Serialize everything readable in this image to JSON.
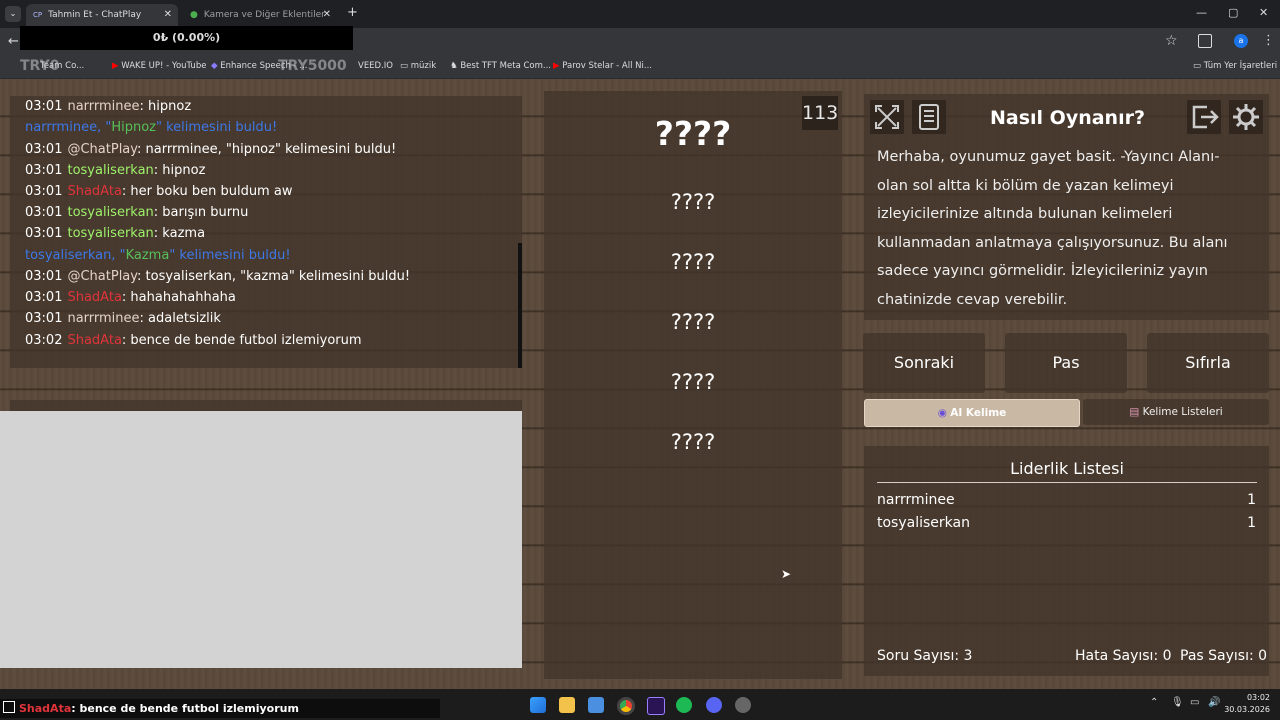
{
  "browser": {
    "tabs": [
      {
        "label": "Tahmin Et - ChatPlay",
        "favicon": "CP",
        "active": true
      },
      {
        "label": "Kamera ve Diğer Eklentiler",
        "active": false
      }
    ],
    "new_tab": "+",
    "window_controls": {
      "minimize": "—",
      "maximize": "▢",
      "close": "✕"
    }
  },
  "overlay": {
    "balance": "0₺ (0.00%)",
    "ghost_left": "TRY0",
    "ghost_right": "TRY5000"
  },
  "bookmarks": {
    "items": [
      "Team Co...",
      "WAKE UP! - YouTube",
      "Enhance Speech - ...",
      "VEED.IO",
      "müzik",
      "Best TFT Meta Com...",
      "Parov Stelar - All Ni..."
    ],
    "all_bookmarks": "Tüm Yer İşaretleri"
  },
  "chat": {
    "lines": [
      {
        "time": "03:01",
        "user": "narrrminee",
        "user_color": "gray",
        "text": ": hipnoz"
      },
      {
        "time": "",
        "user": "narrrminee,",
        "user_color": "blue",
        "text_parts": [
          " \"",
          "Hipnoz",
          "\" kelimesini buldu!"
        ],
        "system": true
      },
      {
        "time": "03:01",
        "user": "@ChatPlay",
        "user_color": "gray",
        "text": ": narrrminee, \"hipnoz\" kelimesini buldu!"
      },
      {
        "time": "03:01",
        "user": "tosyaliserkan",
        "user_color": "green",
        "text": ": hipnoz"
      },
      {
        "time": "03:01",
        "user": "ShadAta",
        "user_color": "red",
        "text": ": her boku ben buldum aw"
      },
      {
        "time": "03:01",
        "user": "tosyaliserkan",
        "user_color": "green",
        "text": ": barışın burnu"
      },
      {
        "time": "03:01",
        "user": "tosyaliserkan",
        "user_color": "green",
        "text": ": kazma"
      },
      {
        "time": "",
        "user": "tosyaliserkan,",
        "user_color": "blue",
        "text_parts": [
          " \"",
          "Kazma",
          "\" kelimesini buldu!"
        ],
        "system": true
      },
      {
        "time": "03:01",
        "user": "@ChatPlay",
        "user_color": "gray",
        "text": ": tosyaliserkan, \"kazma\" kelimesini buldu!"
      },
      {
        "time": "03:01",
        "user": "ShadAta",
        "user_color": "red",
        "text": ": hahahahahhaha"
      },
      {
        "time": "03:01",
        "user": "narrrminee",
        "user_color": "gray",
        "text": ": adaletsizlik"
      },
      {
        "time": "03:02",
        "user": "ShadAta",
        "user_color": "red",
        "text": ": bence de bende futbol izlemiyorum"
      }
    ]
  },
  "words": {
    "main": "????",
    "forbidden": [
      "????",
      "????",
      "????",
      "????",
      "????"
    ],
    "timer": "113"
  },
  "rules": {
    "title": "Nasıl Oynanır?",
    "text_lines": [
      "Merhaba, oyunumuz gayet basit. -Yayıncı Alanı-",
      "olan sol altta ki bölüm de yazan kelimeyi",
      "izleyicilerinize altında bulunan kelimeleri",
      "kullanmadan anlatmaya çalışıyorsunuz. Bu alanı",
      "sadece yayıncı görmelidir. İzleyicileriniz yayın",
      "chatinizde cevap verebilir."
    ]
  },
  "controls": {
    "next": "Sonraki",
    "pass": "Pas",
    "reset": "Sıfırla",
    "ai_word": "AI Kelime",
    "word_lists": "Kelime Listeleri"
  },
  "leaderboard": {
    "title": "Liderlik Listesi",
    "entries": [
      {
        "name": "narrrminee",
        "score": "1"
      },
      {
        "name": "tosyaliserkan",
        "score": "1"
      }
    ]
  },
  "stats": {
    "questions": "Soru Sayısı: 3",
    "errors": "Hata Sayısı: 0",
    "passes": "Pas Sayısı: 0"
  },
  "taskbar": {
    "last_message_user": "ShadAta",
    "last_message_text": ": bence de bende futbol izlemiyorum",
    "clock_time": "03:02",
    "clock_date": "30.03.2026"
  }
}
